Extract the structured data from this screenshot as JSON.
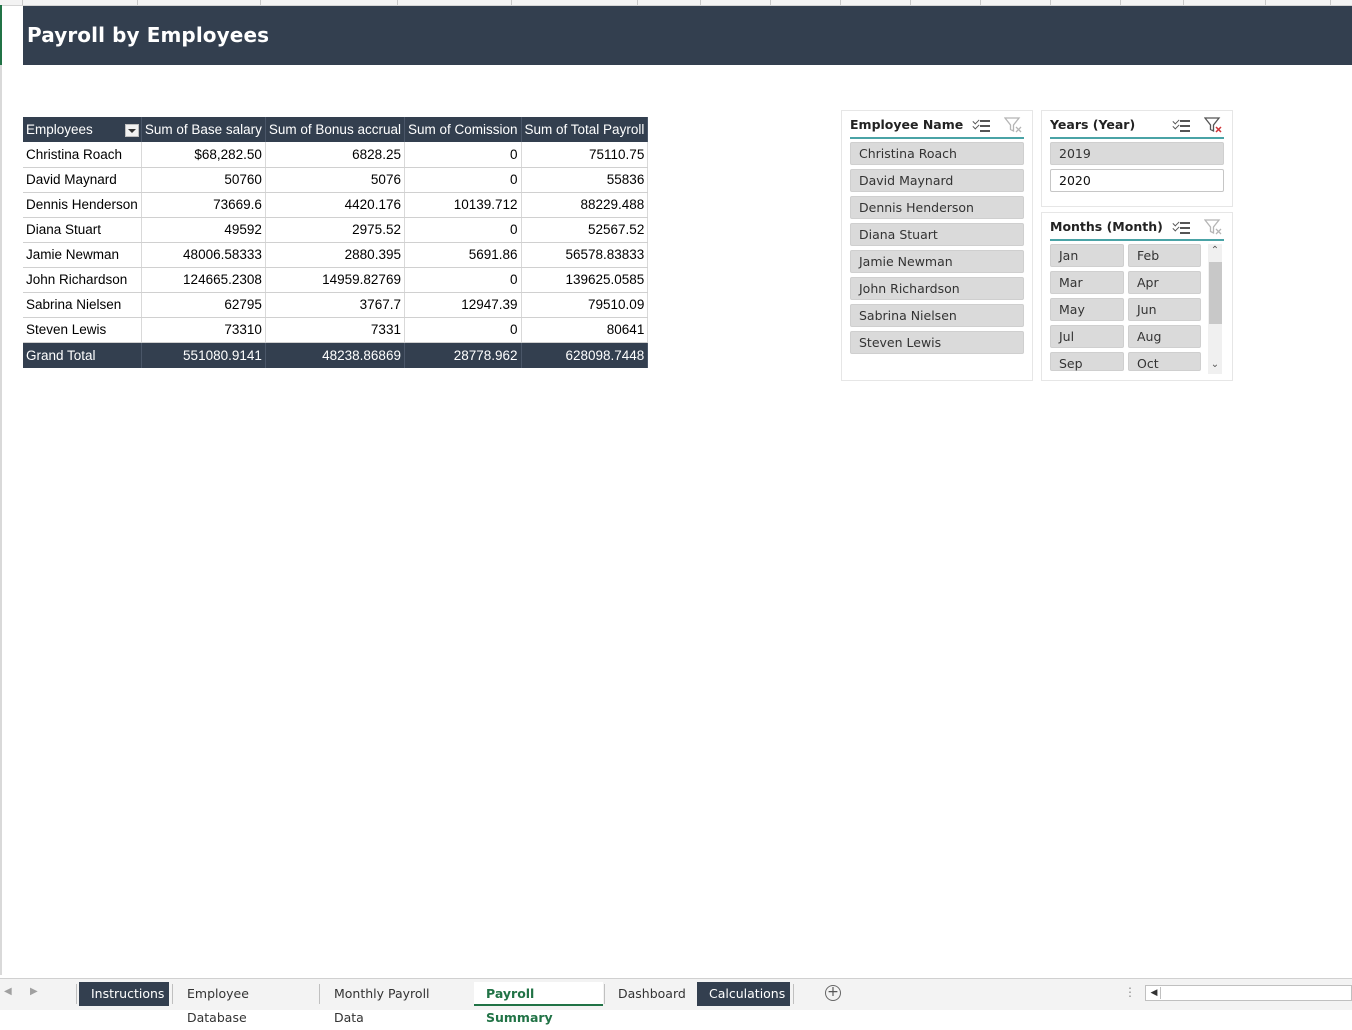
{
  "banner": {
    "title": "Payroll by Employees"
  },
  "pivot": {
    "headers": [
      "Employees",
      "Sum of Base salary",
      "Sum of Bonus accrual",
      "Sum of Comission",
      "Sum of Total Payroll"
    ],
    "rows": [
      [
        "Christina Roach",
        "$68,282.50",
        "6828.25",
        "0",
        "75110.75"
      ],
      [
        "David Maynard",
        "50760",
        "5076",
        "0",
        "55836"
      ],
      [
        "Dennis Henderson",
        "73669.6",
        "4420.176",
        "10139.712",
        "88229.488"
      ],
      [
        "Diana Stuart",
        "49592",
        "2975.52",
        "0",
        "52567.52"
      ],
      [
        "Jamie Newman",
        "48006.58333",
        "2880.395",
        "5691.86",
        "56578.83833"
      ],
      [
        "John Richardson",
        "124665.2308",
        "14959.82769",
        "0",
        "139625.0585"
      ],
      [
        "Sabrina Nielsen",
        "62795",
        "3767.7",
        "12947.39",
        "79510.09"
      ],
      [
        "Steven Lewis",
        "73310",
        "7331",
        "0",
        "80641"
      ]
    ],
    "total": [
      "Grand Total",
      "551080.9141",
      "48238.86869",
      "28778.962",
      "628098.7448"
    ]
  },
  "slicers": {
    "employee": {
      "title": "Employee Name",
      "items": [
        "Christina Roach",
        "David Maynard",
        "Dennis Henderson",
        "Diana Stuart",
        "Jamie Newman",
        "John Richardson",
        "Sabrina Nielsen",
        "Steven Lewis"
      ]
    },
    "years": {
      "title": "Years (Year)",
      "items": [
        "2019",
        "2020"
      ]
    },
    "months": {
      "title": "Months (Month)",
      "items": [
        "Jan",
        "Feb",
        "Mar",
        "Apr",
        "May",
        "Jun",
        "Jul",
        "Aug",
        "Sep",
        "Oct"
      ]
    }
  },
  "tabs": {
    "sheets": [
      "Instructions",
      "Employee Database",
      "Monthly Payroll Data",
      "Payroll Summary",
      "Dashboard",
      "Calculations"
    ],
    "active": "Payroll Summary",
    "add_label": "+"
  },
  "colors": {
    "header_bg": "#333f4f",
    "accent_teal": "#4aa3a6",
    "active_tab": "#217346"
  }
}
